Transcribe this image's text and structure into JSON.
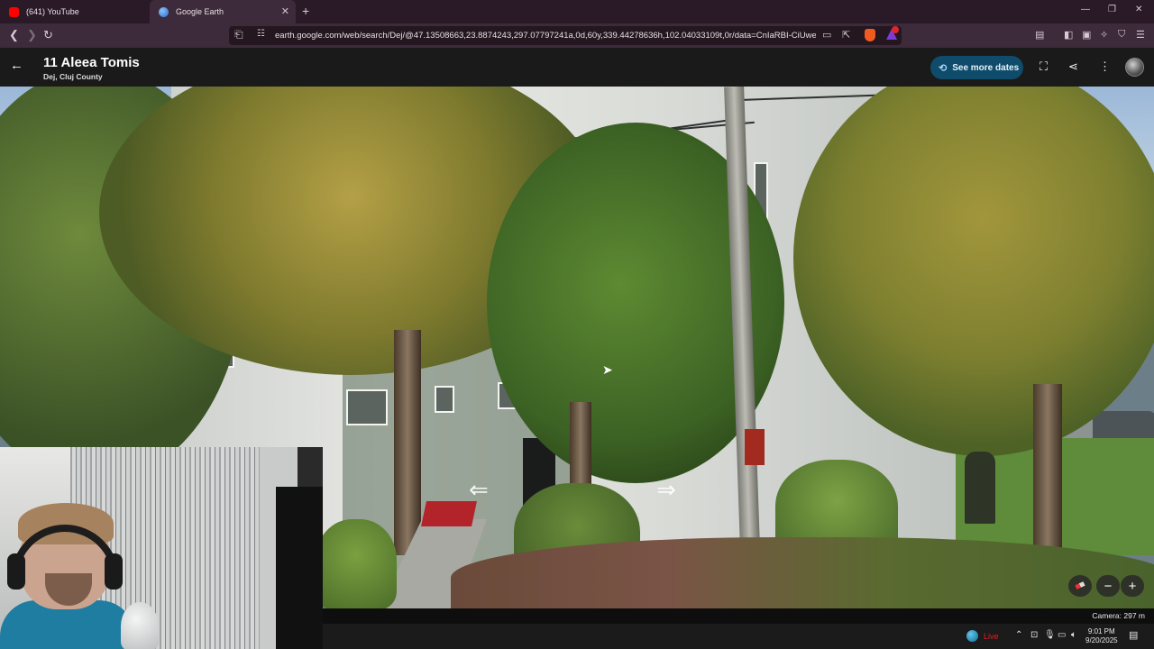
{
  "browser": {
    "tabs": [
      {
        "label": "(641) YouTube",
        "active": false,
        "favicon_color": "#ff0000"
      },
      {
        "label": "Google Earth",
        "active": true,
        "favicon_color": "#4a90e2"
      }
    ],
    "url": "earth.google.com/web/search/Dej/@47.13508663,23.8874243,297.07797241a,0d,60y,339.44278636h,102.04033109t,0r/data=CnIaRBI-CiUweDQ...",
    "new_tab_glyph": "+",
    "window_controls": [
      "—",
      "❐",
      "✕"
    ]
  },
  "earth": {
    "title": "11 Aleea Tomis",
    "subtitle": "Dej, Cluj County",
    "see_more_dates": "See more dates",
    "camera_readout": "Camera: 297 m",
    "zoom_out": "−",
    "zoom_in": "+"
  },
  "taskbar": {
    "live_label": "Live",
    "time": "9:01 PM",
    "date": "9/20/2025"
  },
  "colors": {
    "accent": "#0f4c6b",
    "tab_bar": "#2a1a28",
    "address_bar": "#3d2a3a",
    "header": "#1a1a1a"
  }
}
